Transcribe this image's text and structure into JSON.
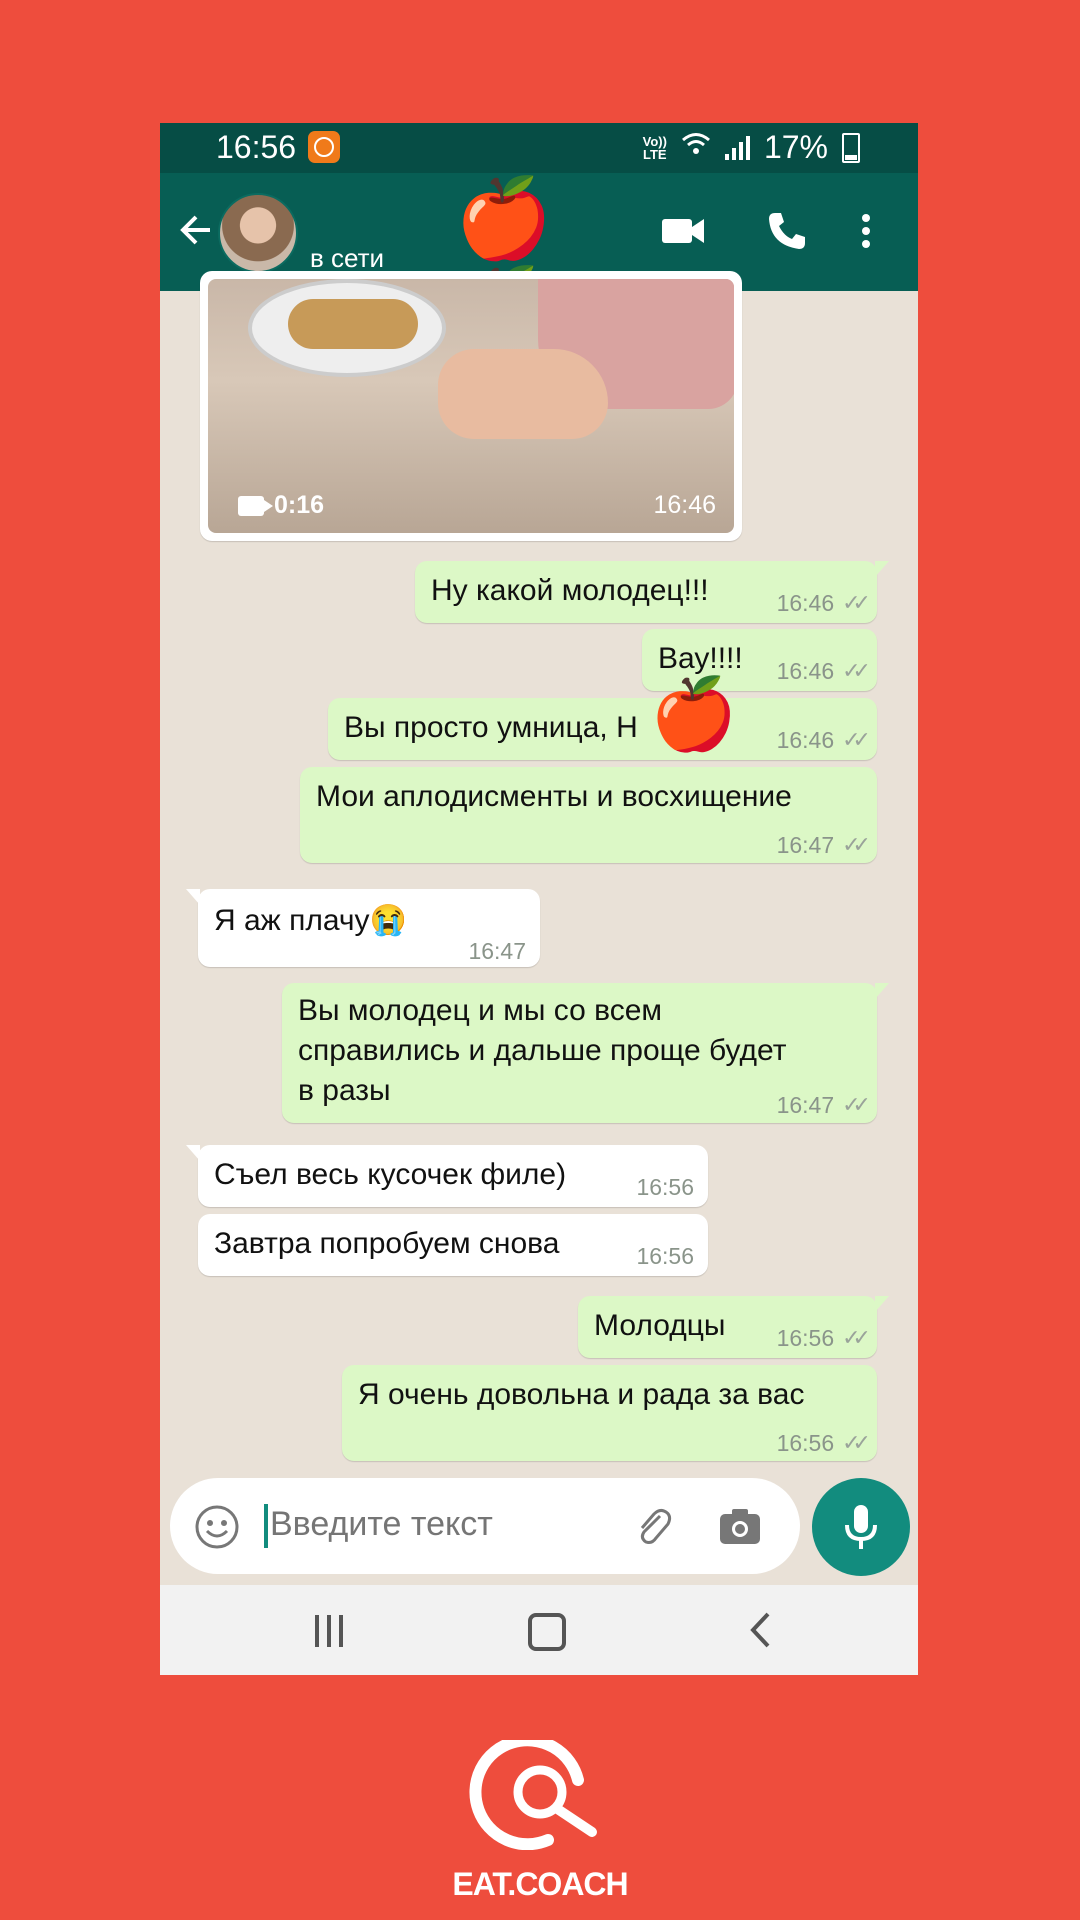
{
  "status_bar": {
    "time": "16:56",
    "network_label_top": "Vo))",
    "network_label_bottom": "LTE",
    "battery": "17%"
  },
  "header": {
    "contact_name": "",
    "status": "в сети",
    "name_overlay": "🍎🍎🍎🍎"
  },
  "video_message": {
    "duration": "0:16",
    "time": "16:46"
  },
  "messages": [
    {
      "text": "Ну какой молодец!!!",
      "time": "16:46",
      "ticks": "✓✓"
    },
    {
      "text": "Вау!!!!",
      "time": "16:46",
      "ticks": "✓✓"
    },
    {
      "text": "Вы просто умница, Н",
      "text_end": "!",
      "overlay": "🍎",
      "time": "16:46",
      "ticks": "✓✓"
    },
    {
      "text": "Мои аплодисменты и восхищение",
      "time": "16:47",
      "ticks": "✓✓"
    },
    {
      "text": "Я аж плачу😭",
      "time": "16:47"
    },
    {
      "text_lines": [
        "Вы молодец и мы со всем",
        "справились и дальше проще будет",
        "в разы"
      ],
      "time": "16:47",
      "ticks": "✓✓"
    },
    {
      "text": "Съел весь кусочек филе)",
      "time": "16:56"
    },
    {
      "text": "Завтра попробуем снова",
      "time": "16:56"
    },
    {
      "text": "Молодцы",
      "time": "16:56",
      "ticks": "✓✓"
    },
    {
      "text": "Я очень довольна и рада за вас",
      "time": "16:56",
      "ticks": "✓✓"
    }
  ],
  "input": {
    "placeholder": "Введите текст"
  },
  "branding": {
    "logo_text": "EAT.COACH"
  },
  "colors": {
    "background": "#ee4d3d",
    "header": "#075e54",
    "outgoing_bubble": "#dcf8c6",
    "accent": "#128c7e"
  }
}
